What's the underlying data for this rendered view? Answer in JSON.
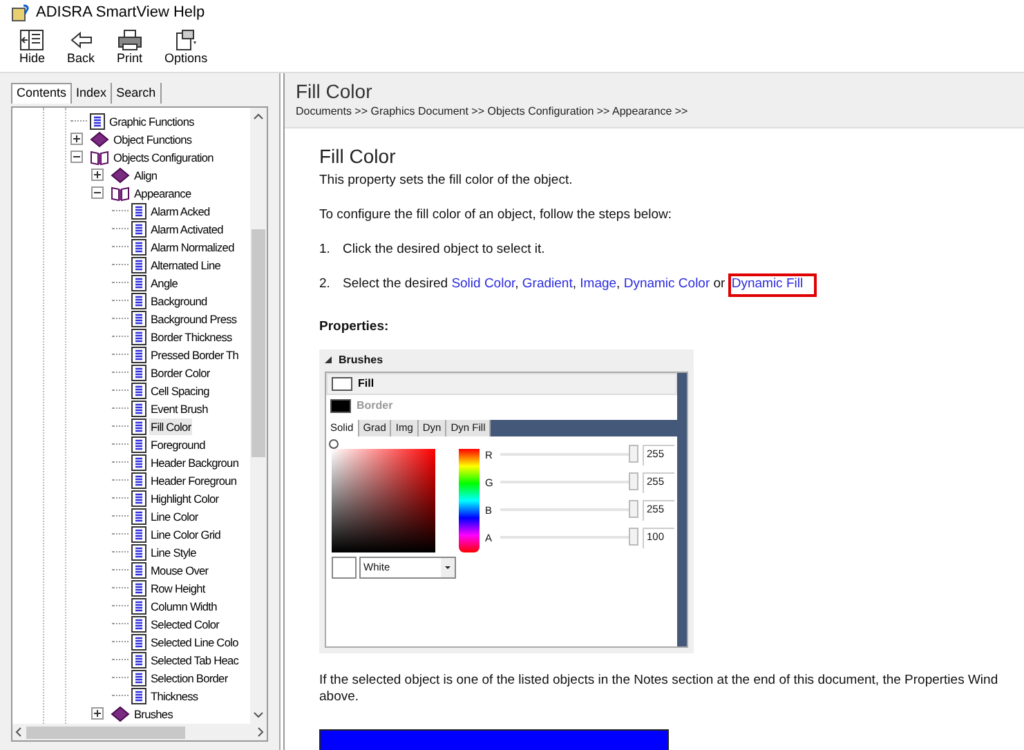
{
  "window": {
    "title": "ADISRA SmartView Help"
  },
  "toolbar": [
    {
      "label": "Hide",
      "kind": "hide"
    },
    {
      "label": "Back",
      "kind": "back"
    },
    {
      "label": "Print",
      "kind": "print"
    },
    {
      "label": "Options",
      "kind": "options"
    }
  ],
  "nav_tabs": [
    {
      "label": "Contents",
      "selected": true
    },
    {
      "label": "Index",
      "selected": false
    },
    {
      "label": "Search",
      "selected": false
    }
  ],
  "tree": [
    {
      "label": "Graphic Functions",
      "kind": "page",
      "selected": false
    },
    {
      "label": "Object Functions",
      "kind": "book",
      "expanded": false,
      "selected": false
    },
    {
      "label": "Objects Configuration",
      "kind": "book",
      "expanded": true,
      "selected": false,
      "children": [
        {
          "label": "Align",
          "kind": "book",
          "expanded": false,
          "selected": false
        },
        {
          "label": "Appearance",
          "kind": "book",
          "expanded": true,
          "selected": false,
          "children": [
            {
              "label": "Alarm Acked",
              "kind": "page",
              "selected": false
            },
            {
              "label": "Alarm Activated",
              "kind": "page",
              "selected": false
            },
            {
              "label": "Alarm Normalized",
              "kind": "page",
              "selected": false
            },
            {
              "label": "Alternated Line",
              "kind": "page",
              "selected": false
            },
            {
              "label": "Angle",
              "kind": "page",
              "selected": false
            },
            {
              "label": "Background",
              "kind": "page",
              "selected": false
            },
            {
              "label": "Background Press",
              "kind": "page",
              "selected": false
            },
            {
              "label": "Border Thickness",
              "kind": "page",
              "selected": false
            },
            {
              "label": "Pressed Border Th",
              "kind": "page",
              "selected": false
            },
            {
              "label": "Border Color",
              "kind": "page",
              "selected": false
            },
            {
              "label": "Cell Spacing",
              "kind": "page",
              "selected": false
            },
            {
              "label": "Event Brush",
              "kind": "page",
              "selected": false
            },
            {
              "label": "Fill Color",
              "kind": "page",
              "selected": true
            },
            {
              "label": "Foreground",
              "kind": "page",
              "selected": false
            },
            {
              "label": "Header Backgroun",
              "kind": "page",
              "selected": false
            },
            {
              "label": "Header Foregroun",
              "kind": "page",
              "selected": false
            },
            {
              "label": "Highlight Color",
              "kind": "page",
              "selected": false
            },
            {
              "label": "Line Color",
              "kind": "page",
              "selected": false
            },
            {
              "label": "Line Color Grid",
              "kind": "page",
              "selected": false
            },
            {
              "label": "Line Style",
              "kind": "page",
              "selected": false
            },
            {
              "label": "Mouse Over",
              "kind": "page",
              "selected": false
            },
            {
              "label": "Row Height",
              "kind": "page",
              "selected": false
            },
            {
              "label": "Column Width",
              "kind": "page",
              "selected": false
            },
            {
              "label": "Selected Color",
              "kind": "page",
              "selected": false
            },
            {
              "label": "Selected Line Colo",
              "kind": "page",
              "selected": false
            },
            {
              "label": "Selected Tab Heac",
              "kind": "page",
              "selected": false
            },
            {
              "label": "Selection Border",
              "kind": "page",
              "selected": false
            },
            {
              "label": "Thickness",
              "kind": "page",
              "selected": false
            }
          ]
        },
        {
          "label": "Brushes",
          "kind": "book",
          "expanded": false,
          "selected": false
        }
      ]
    }
  ],
  "topic_header": {
    "title": "Fill Color",
    "breadcrumb": "Documents >> Graphics Document >> Objects Configuration >> Appearance >>"
  },
  "content": {
    "heading": "Fill Color",
    "intro": "This property sets the fill color of the object.",
    "lead": "To configure the fill color of an object, follow the steps below:",
    "steps": [
      {
        "number": "1.",
        "parts": [
          {
            "kind": "text",
            "text": "Click the desired object to select it."
          }
        ]
      },
      {
        "number": "2.",
        "parts": [
          {
            "kind": "text",
            "text": "Select the desired "
          },
          {
            "kind": "link",
            "text": "Solid Color",
            "highlighted": false
          },
          {
            "kind": "text",
            "text": ", "
          },
          {
            "kind": "link",
            "text": "Gradient",
            "highlighted": false
          },
          {
            "kind": "text",
            "text": ", "
          },
          {
            "kind": "link",
            "text": "Image",
            "highlighted": false
          },
          {
            "kind": "text",
            "text": ", "
          },
          {
            "kind": "link",
            "text": "Dynamic Color",
            "highlighted": false
          },
          {
            "kind": "text",
            "text": " or "
          },
          {
            "kind": "link",
            "text": "Dynamic Fill",
            "highlighted": true
          }
        ]
      }
    ],
    "properties_label": "Properties:",
    "brushes_panel": {
      "title": "Brushes",
      "items": [
        {
          "label": "Fill",
          "color": "#ffffff",
          "selected": true
        },
        {
          "label": "Border",
          "color": "#000000",
          "selected": false
        }
      ],
      "tabs": [
        {
          "label": "Solid",
          "selected": true
        },
        {
          "label": "Grad",
          "selected": false
        },
        {
          "label": "Img",
          "selected": false
        },
        {
          "label": "Dyn",
          "selected": false
        },
        {
          "label": "Dyn Fill",
          "selected": false
        }
      ],
      "channels": [
        {
          "name": "R",
          "level": 1,
          "value": "255"
        },
        {
          "name": "G",
          "level": 1,
          "value": "255"
        },
        {
          "name": "B",
          "level": 1,
          "value": "255"
        },
        {
          "name": "A",
          "level": 1,
          "value": "100"
        }
      ],
      "color_name": "White"
    },
    "note": "If the selected object is one of the listed objects in the Notes section at the end of this document, the Properties Wind",
    "note_end": "above."
  }
}
